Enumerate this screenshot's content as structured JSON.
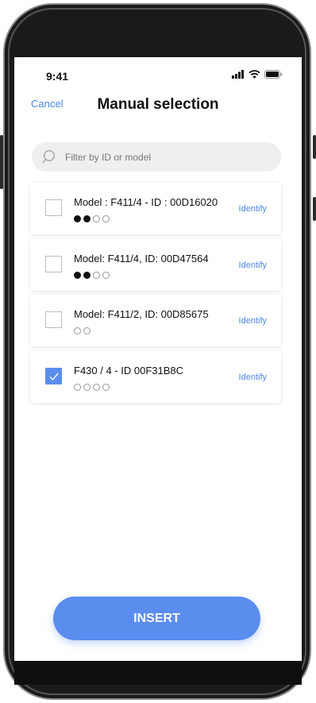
{
  "status": {
    "time": "9:41"
  },
  "nav": {
    "cancel_label": "Cancel",
    "title": "Manual selection"
  },
  "search": {
    "placeholder": "Filter by ID or model",
    "value": ""
  },
  "items": [
    {
      "title": "Model : F411/4 - ID : 00D16020",
      "dots": [
        "filled",
        "filled",
        "empty",
        "empty"
      ],
      "checked": false,
      "identify_label": "Identify"
    },
    {
      "title": "Model: F411/4, ID: 00D47564",
      "dots": [
        "filled",
        "filled",
        "empty",
        "empty"
      ],
      "checked": false,
      "identify_label": "Identify"
    },
    {
      "title": "Model: F411/2, ID: 00D85675",
      "dots": [
        "empty",
        "empty"
      ],
      "checked": false,
      "identify_label": "Identify"
    },
    {
      "title": "F430 / 4 - ID 00F31B8C",
      "dots": [
        "empty",
        "empty",
        "empty",
        "empty"
      ],
      "checked": true,
      "identify_label": "Identify"
    }
  ],
  "insert_label": "INSERT",
  "colors": {
    "accent": "#5b8def",
    "link": "#4a86e8"
  }
}
